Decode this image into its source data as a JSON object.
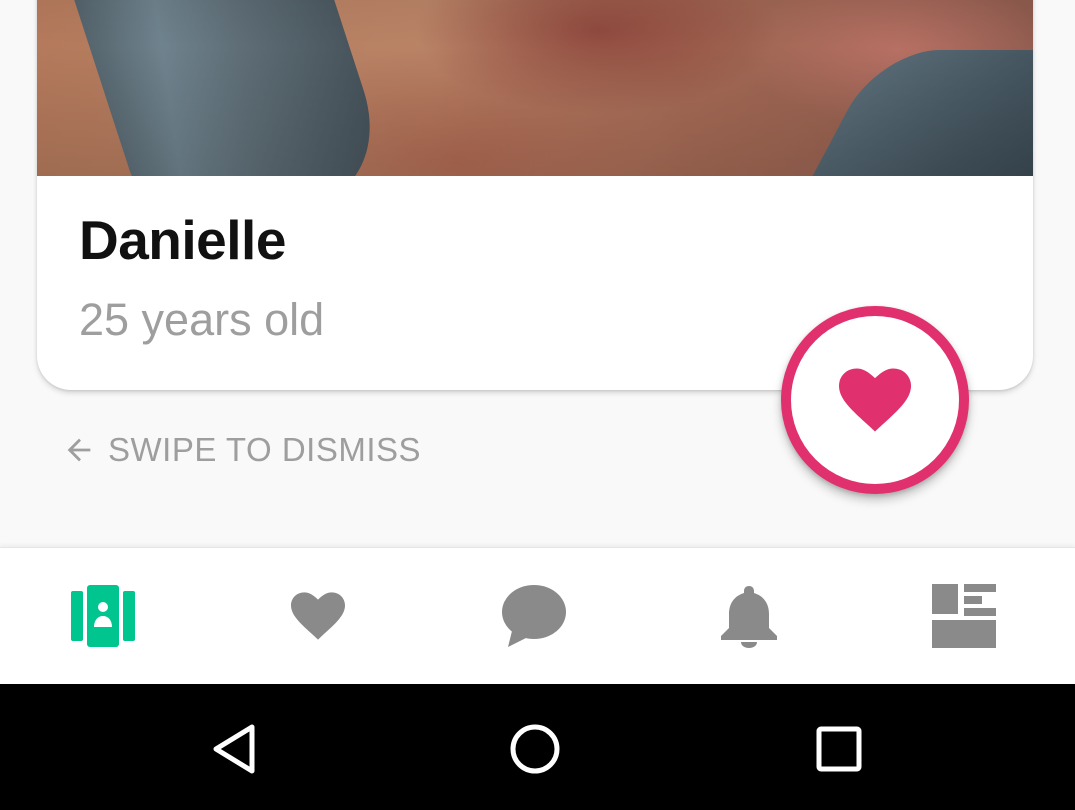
{
  "profile": {
    "name": "Danielle",
    "age_text": "25 years old",
    "photo": "profile-photo"
  },
  "swipe_hint": {
    "icon": "arrow-left-icon",
    "label": "SWIPE TO DISMISS"
  },
  "like_button": {
    "icon": "heart-icon",
    "ring_color": "#e0306d",
    "heart_color": "#e0306d"
  },
  "bottom_nav": {
    "active_color": "#00c58e",
    "inactive_color": "#8a8a8a",
    "items": [
      {
        "icon": "cards-icon",
        "active": true
      },
      {
        "icon": "heart-icon",
        "active": false
      },
      {
        "icon": "chat-bubble-icon",
        "active": false
      },
      {
        "icon": "bell-icon",
        "active": false
      },
      {
        "icon": "dashboard-icon",
        "active": false
      }
    ]
  },
  "system_nav": {
    "buttons": [
      "back-triangle-icon",
      "home-circle-icon",
      "recents-square-icon"
    ]
  }
}
